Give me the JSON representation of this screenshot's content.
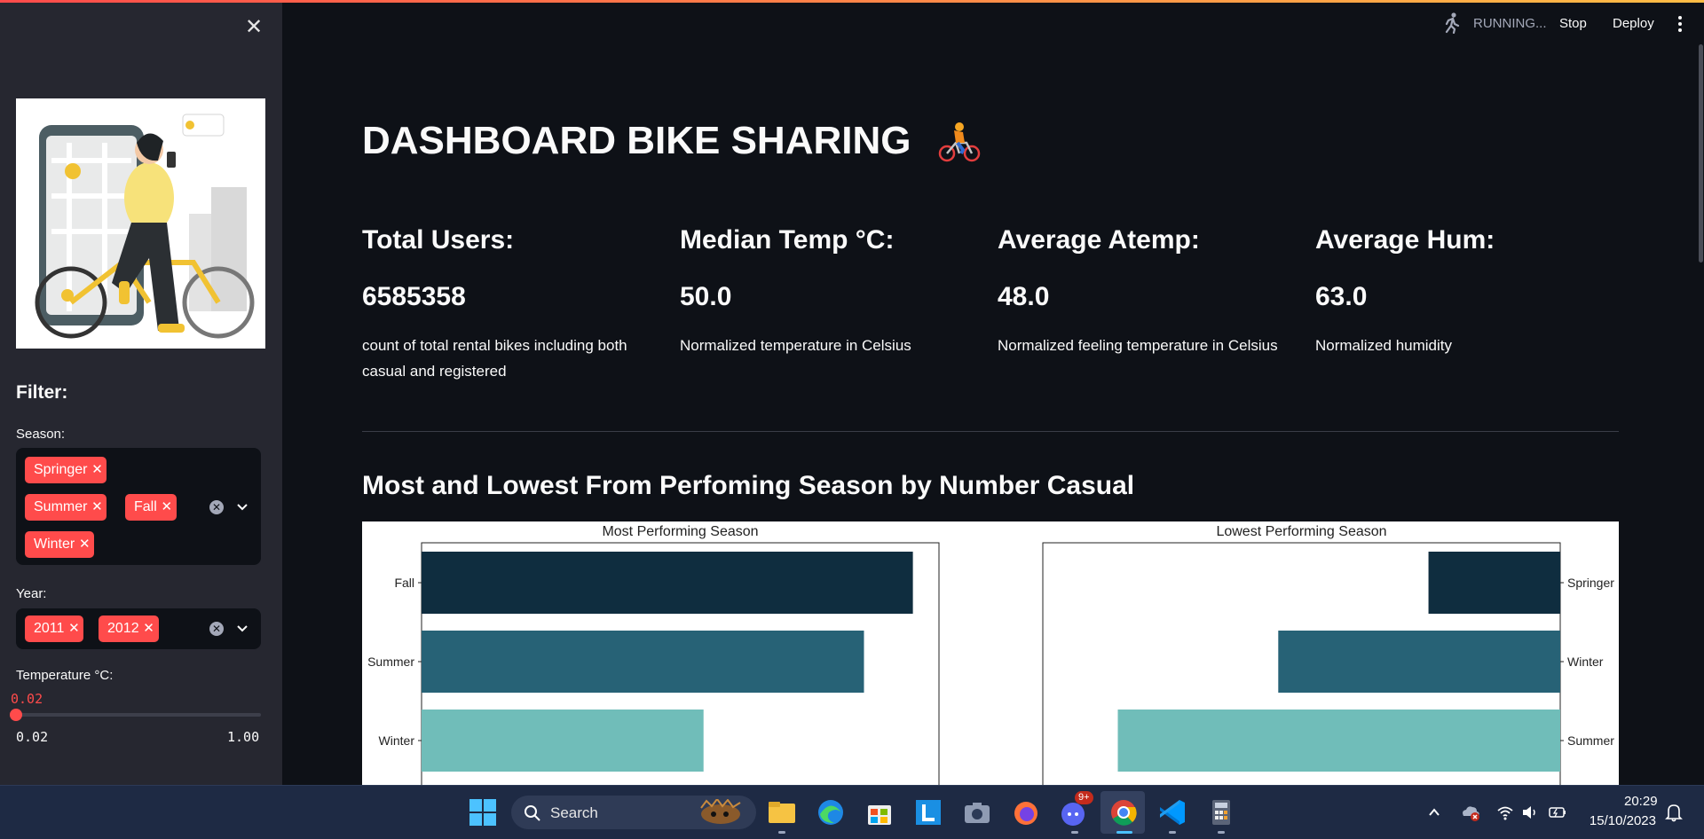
{
  "header": {
    "status": "RUNNING...",
    "stop_label": "Stop",
    "deploy_label": "Deploy"
  },
  "sidebar": {
    "filter_heading": "Filter:",
    "season": {
      "label": "Season:",
      "selected": [
        "Springer",
        "Summer",
        "Fall",
        "Winter"
      ]
    },
    "year": {
      "label": "Year:",
      "selected": [
        "2011",
        "2012"
      ]
    },
    "temperature": {
      "label": "Temperature °C:",
      "value": "0.02",
      "min": "0.02",
      "max": "1.00"
    }
  },
  "main": {
    "title": "DASHBOARD BIKE SHARING",
    "metrics": [
      {
        "label": "Total Users:",
        "value": "6585358",
        "description": "count of total rental bikes including both casual and registered"
      },
      {
        "label": "Median Temp °C:",
        "value": "50.0",
        "description": "Normalized temperature in Celsius"
      },
      {
        "label": "Average Atemp:",
        "value": "48.0",
        "description": "Normalized feeling temperature in Celsius"
      },
      {
        "label": "Average Hum:",
        "value": "63.0",
        "description": "Normalized humidity"
      }
    ],
    "section_title": "Most and Lowest From Perfoming Season by Number Casual"
  },
  "chart_data": [
    {
      "type": "bar",
      "orientation": "horizontal",
      "title": "Most Performing Season",
      "categories": [
        "Fall",
        "Summer",
        "Winter"
      ],
      "values": [
        226000,
        203500,
        129700
      ],
      "xlim": [
        0,
        238000
      ],
      "colors": [
        "#0f2d3f",
        "#276276",
        "#70bdb9"
      ]
    },
    {
      "type": "bar",
      "orientation": "horizontal",
      "title": "Lowest Performing Season",
      "categories": [
        "Springer",
        "Winter",
        "Summer"
      ],
      "values": [
        60600,
        129700,
        203500
      ],
      "xlim": [
        238000,
        0
      ],
      "colors": [
        "#0f2d3f",
        "#276276",
        "#70bdb9"
      ]
    }
  ],
  "taskbar": {
    "search_placeholder": "Search",
    "discord_badge": "9+",
    "time": "20:29",
    "date": "15/10/2023"
  }
}
